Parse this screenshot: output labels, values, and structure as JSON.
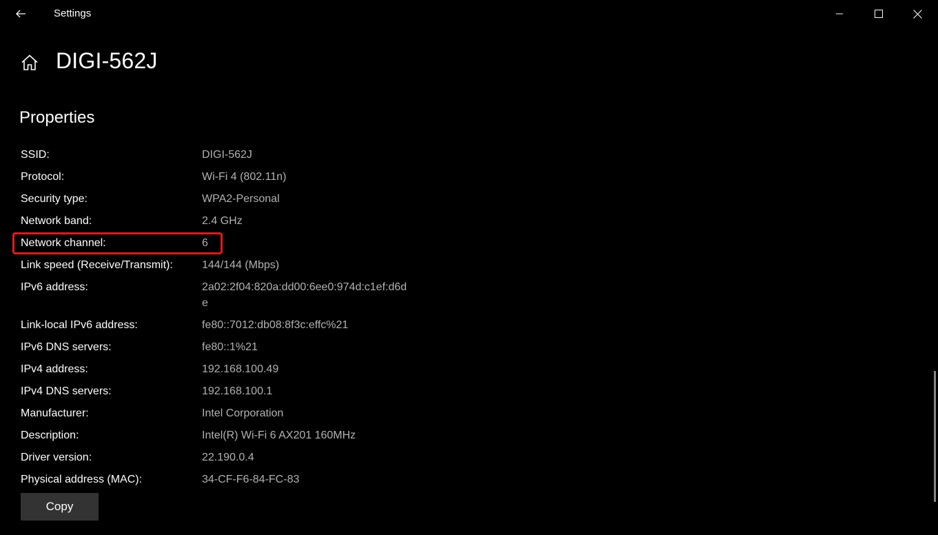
{
  "titlebar": {
    "app_title": "Settings"
  },
  "header": {
    "page_title": "DIGI-562J",
    "section_title": "Properties"
  },
  "properties": [
    {
      "label": "SSID:",
      "value": "DIGI-562J"
    },
    {
      "label": "Protocol:",
      "value": "Wi-Fi 4 (802.11n)"
    },
    {
      "label": "Security type:",
      "value": "WPA2-Personal"
    },
    {
      "label": "Network band:",
      "value": "2.4 GHz"
    },
    {
      "label": "Network channel:",
      "value": "6"
    },
    {
      "label": "Link speed (Receive/Transmit):",
      "value": "144/144 (Mbps)"
    },
    {
      "label": "IPv6 address:",
      "value": "2a02:2f04:820a:dd00:6ee0:974d:c1ef:d6de"
    },
    {
      "label": "Link-local IPv6 address:",
      "value": "fe80::7012:db08:8f3c:effc%21"
    },
    {
      "label": "IPv6 DNS servers:",
      "value": "fe80::1%21"
    },
    {
      "label": "IPv4 address:",
      "value": "192.168.100.49"
    },
    {
      "label": "IPv4 DNS servers:",
      "value": "192.168.100.1"
    },
    {
      "label": "Manufacturer:",
      "value": "Intel Corporation"
    },
    {
      "label": "Description:",
      "value": "Intel(R) Wi-Fi 6 AX201 160MHz"
    },
    {
      "label": "Driver version:",
      "value": "22.190.0.4"
    },
    {
      "label": "Physical address (MAC):",
      "value": "34-CF-F6-84-FC-83"
    }
  ],
  "copy_button": {
    "label": "Copy"
  },
  "colors": {
    "background": "#000000",
    "highlight": "#e01b1b",
    "value_text": "#b3b3b3",
    "button_bg": "#333333"
  },
  "icons": [
    "back-arrow-icon",
    "minimize-icon",
    "maximize-icon",
    "close-icon",
    "home-icon"
  ]
}
